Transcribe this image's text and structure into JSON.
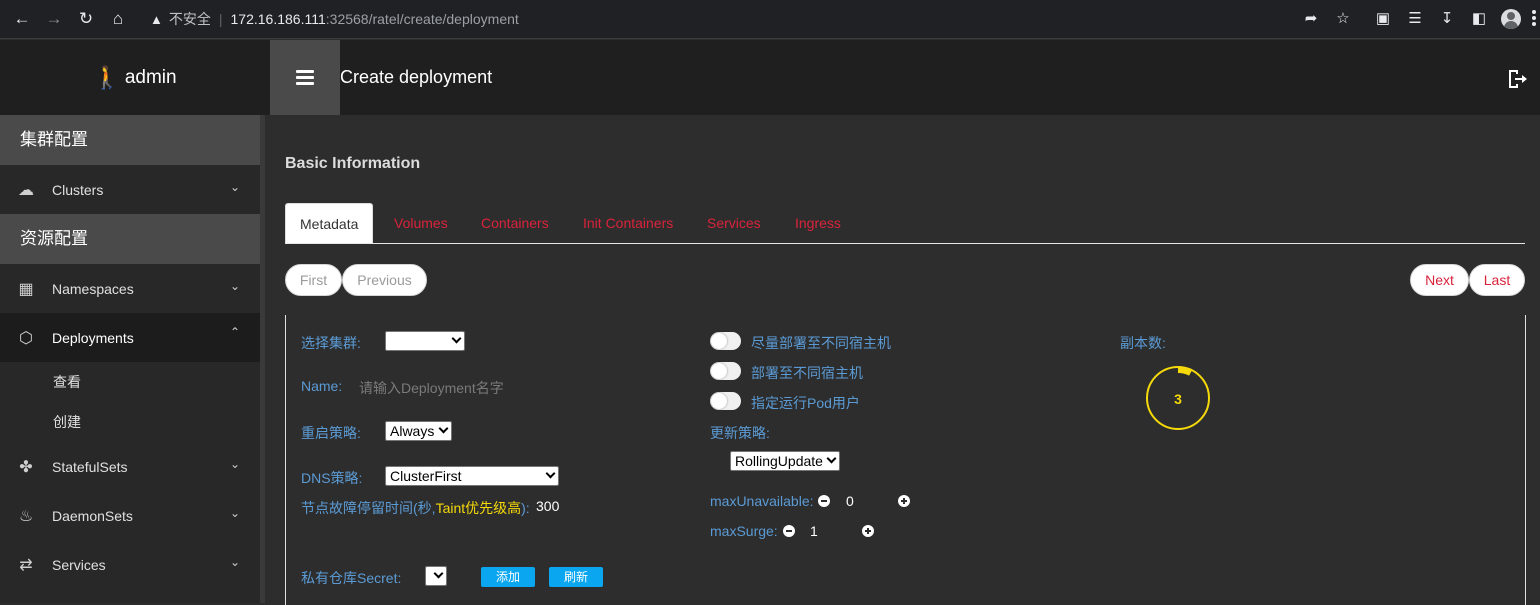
{
  "browser": {
    "insecure_label": "不安全",
    "url_host": "172.16.186.111",
    "url_path": ":32568/ratel/create/deployment"
  },
  "header": {
    "user": "admin",
    "title": "Create deployment"
  },
  "sidebar": {
    "section1": "集群配置",
    "clusters": "Clusters",
    "section2": "资源配置",
    "namespaces": "Namespaces",
    "deployments": "Deployments",
    "sub_view": "查看",
    "sub_create": "创建",
    "statefulsets": "StatefulSets",
    "daemonsets": "DaemonSets",
    "services": "Services"
  },
  "main": {
    "panel_title": "Basic Information",
    "tabs": [
      "Metadata",
      "Volumes",
      "Containers",
      "Init Containers",
      "Services",
      "Ingress"
    ],
    "pager": {
      "first": "First",
      "previous": "Previous",
      "next": "Next",
      "last": "Last"
    }
  },
  "form": {
    "cluster_label": "选择集群:",
    "name_label": "Name:",
    "name_placeholder": "请输入Deployment名字",
    "restart_label": "重启策略:",
    "restart_value": "Always",
    "dns_label": "DNS策略:",
    "dns_value": "ClusterFirst",
    "taint_label_a": "节点故障停留时间(秒,",
    "taint_label_b": "Taint优先级高",
    "taint_label_c": "):",
    "taint_value": "300",
    "secret_label": "私有仓库Secret:",
    "add_btn": "添加",
    "refresh_btn": "刷新",
    "toggle1": "尽量部署至不同宿主机",
    "toggle2": "部署至不同宿主机",
    "toggle3": "指定运行Pod用户",
    "update_label": "更新策略:",
    "update_value": "RollingUpdate",
    "max_unavailable_label": "maxUnavailable:",
    "max_unavailable_value": "0",
    "max_surge_label": "maxSurge:",
    "max_surge_value": "1",
    "replicas_label": "副本数:",
    "replicas_value": "3"
  },
  "colors": {
    "tab_red": "#d9233b",
    "label_blue": "#5b9bd5",
    "button_blue": "#0aa6f0",
    "gauge_yellow": "#f5d90a"
  }
}
